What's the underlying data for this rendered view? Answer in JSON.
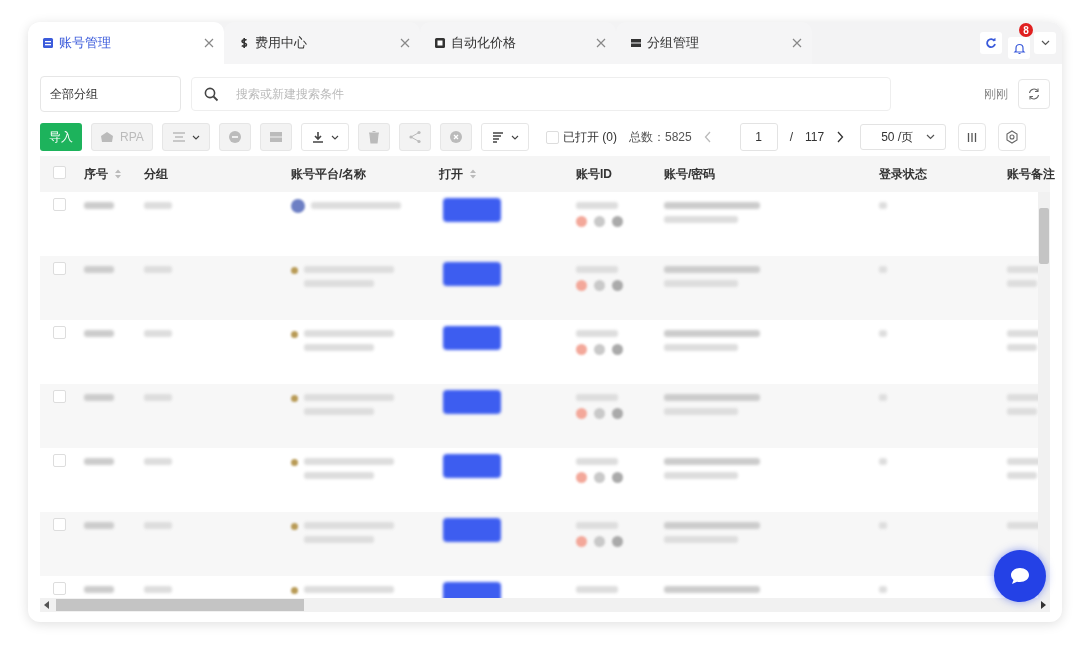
{
  "tabs": [
    {
      "label": "账号管理",
      "selected": true
    },
    {
      "label": "费用中心",
      "selected": false
    },
    {
      "label": "自动化价格",
      "selected": false
    },
    {
      "label": "分组管理",
      "selected": false
    }
  ],
  "header_actions": {
    "notification_count": "8"
  },
  "filters": {
    "group": "全部分组",
    "search": {
      "placeholder": "搜索或新建搜索条件"
    },
    "updated": "刚刚"
  },
  "toolbar": {
    "import_label": "导入",
    "rpa_label": "RPA",
    "rpa_disabled": true,
    "tool_buttons": [
      {
        "disabled": true,
        "menu": true
      },
      {
        "disabled": true,
        "menu": false
      },
      {
        "disabled": true,
        "menu": false
      },
      {
        "disabled": false,
        "menu": true
      },
      {
        "disabled": true,
        "menu": false
      },
      {
        "disabled": true,
        "menu": false
      },
      {
        "disabled": true,
        "menu": false
      },
      {
        "disabled": false,
        "menu": true
      }
    ]
  },
  "pagination": {
    "opened": {
      "label": "已打开 (0)",
      "checked": false
    },
    "total": "总数：5825",
    "page": "1",
    "separator": "/",
    "pages": "117",
    "page_size": "50 /页"
  },
  "table": {
    "header_checked": false,
    "columns": [
      {
        "label": "序号",
        "sortable": true
      },
      {
        "label": "分组",
        "sortable": false
      },
      {
        "label": "账号平台/名称",
        "sortable": false
      },
      {
        "label": "打开",
        "sortable": true
      },
      {
        "label": "账号ID",
        "sortable": false
      },
      {
        "label": "账号/密码",
        "sortable": false
      },
      {
        "label": "登录状态",
        "sortable": false
      },
      {
        "label": "账号备注",
        "sortable": false
      }
    ],
    "rows": [
      {
        "checked": false
      },
      {
        "checked": false
      },
      {
        "checked": false
      },
      {
        "checked": false
      },
      {
        "checked": false
      },
      {
        "checked": false
      },
      {
        "checked": false
      }
    ]
  }
}
